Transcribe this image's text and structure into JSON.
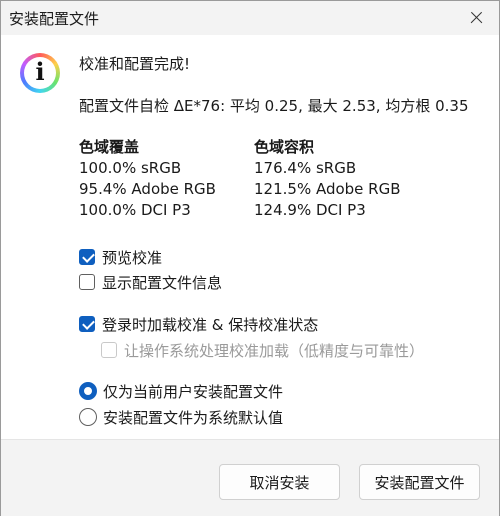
{
  "window": {
    "title": "安装配置文件"
  },
  "message": {
    "headline": "校准和配置完成!",
    "delta_e": "配置文件自检 ΔE*76: 平均 0.25, 最大 2.53, 均方根 0.35"
  },
  "gamut_coverage": {
    "heading": "色域覆盖",
    "lines": [
      "100.0% sRGB",
      "95.4% Adobe RGB",
      "100.0% DCI P3"
    ]
  },
  "gamut_volume": {
    "heading": "色域容积",
    "lines": [
      "176.4% sRGB",
      "121.5% Adobe RGB",
      "124.9% DCI P3"
    ]
  },
  "options": {
    "preview_calibration": {
      "label": "预览校准",
      "checked": true
    },
    "show_profile_info": {
      "label": "显示配置文件信息",
      "checked": false
    },
    "load_on_login": {
      "label": "登录时加载校准 & 保持校准状态",
      "checked": true
    },
    "os_handles_loading": {
      "label": "让操作系统处理校准加载（低精度与可靠性）",
      "checked": false,
      "disabled": true
    }
  },
  "install_scope": {
    "current_user": {
      "label": "仅为当前用户安装配置文件",
      "selected": true
    },
    "system_default": {
      "label": "安装配置文件为系统默认值",
      "selected": false
    }
  },
  "buttons": {
    "cancel": "取消安装",
    "install": "安装配置文件"
  },
  "colors": {
    "accent": "#0f5fbf",
    "titlebar_bg": "#f3f3f3",
    "footer_bg": "#f3f3f3"
  },
  "icons": {
    "info": "info-icon",
    "close": "close-icon"
  }
}
